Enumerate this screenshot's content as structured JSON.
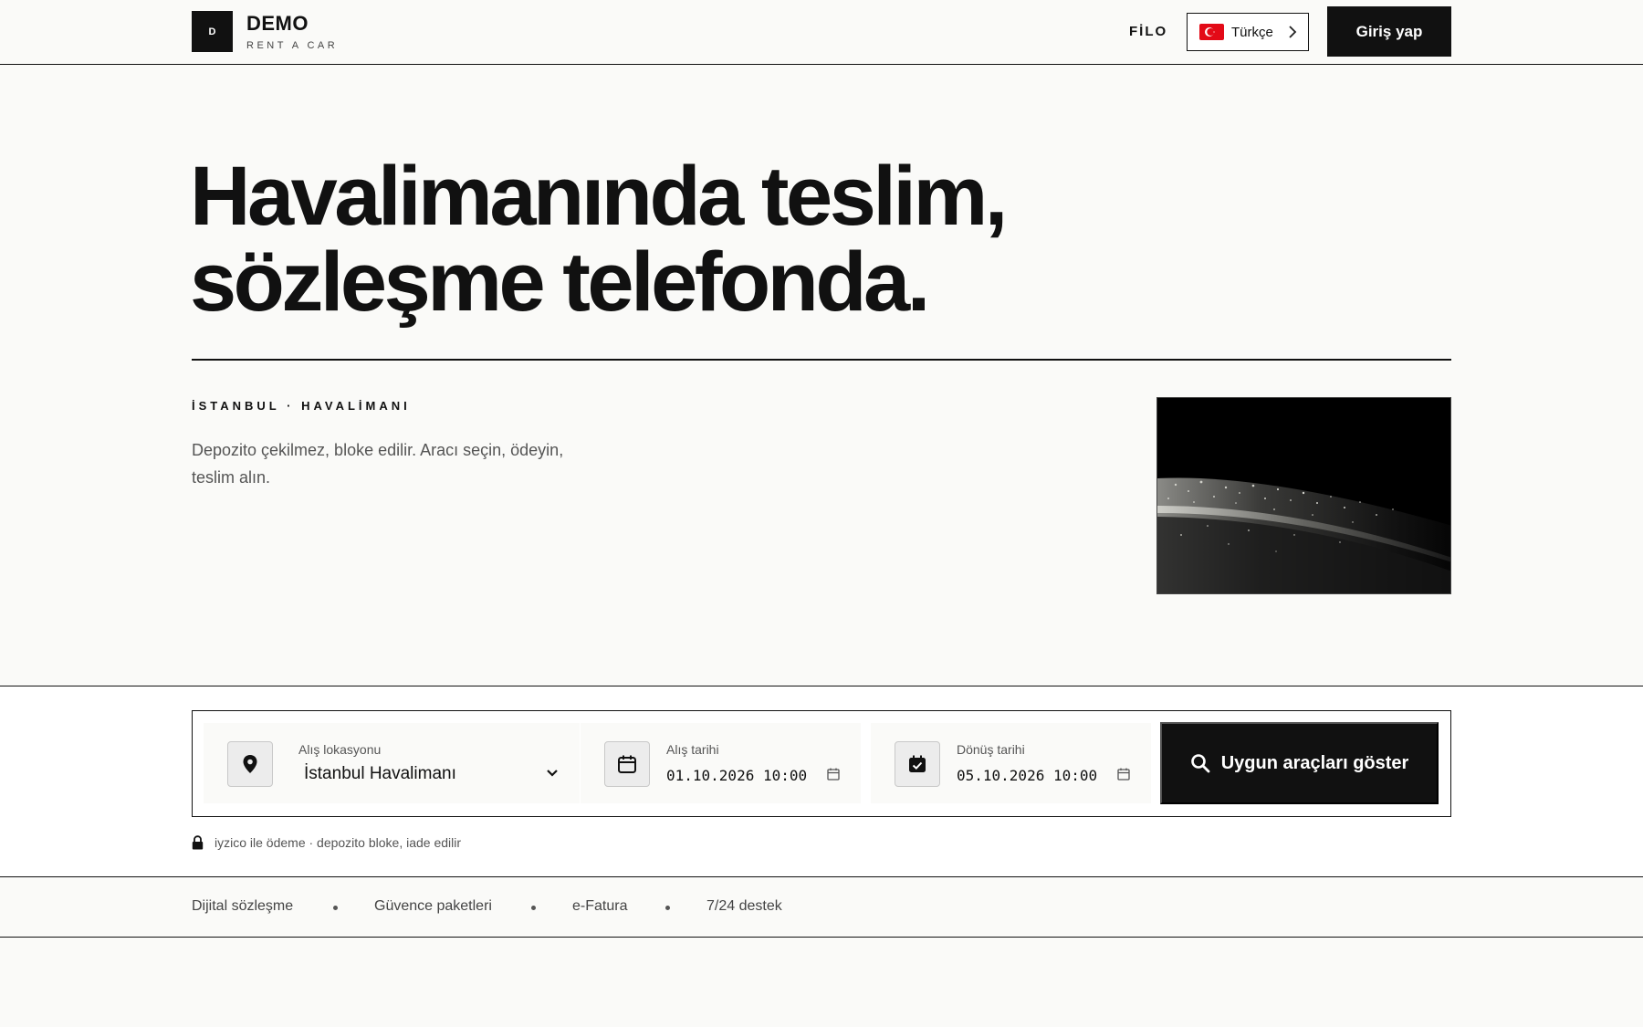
{
  "header": {
    "logo_letter": "D",
    "brand_name": "DEMO",
    "brand_sub": "RENT A CAR",
    "nav_filo": "FİLO",
    "language": "Türkçe",
    "login": "Giriş yap"
  },
  "hero": {
    "title_line1": "Havalimanında teslim,",
    "title_line2": "sözleşme telefonda.",
    "eyebrow": "İSTANBUL · HAVALİMANI",
    "description": "Depozito çekilmez, bloke edilir. Aracı seçin, ödeyin, teslim alın."
  },
  "search": {
    "pickup_location": {
      "label": "Alış lokasyonu",
      "value": "İstanbul Havalimanı"
    },
    "pickup_date": {
      "label": "Alış tarihi",
      "value": "01.10.2026 10:00"
    },
    "return_date": {
      "label": "Dönüş tarihi",
      "value": "05.10.2026 10:00"
    },
    "submit": "Uygun araçları göster",
    "secure_note": "iyzico ile ödeme · depozito bloke, iade edilir"
  },
  "features": [
    "Dijital sözleşme",
    "Güvence paketleri",
    "e-Fatura",
    "7/24 destek"
  ],
  "colors": {
    "background": "#fafaf8",
    "ink": "#111111",
    "muted": "#555555",
    "flag_red": "#e30a17"
  },
  "icons": {
    "pickup_location": "map-pin-icon",
    "pickup_date": "calendar-icon",
    "return_date": "calendar-check-icon",
    "submit": "search-icon",
    "secure_note": "lock-icon"
  }
}
